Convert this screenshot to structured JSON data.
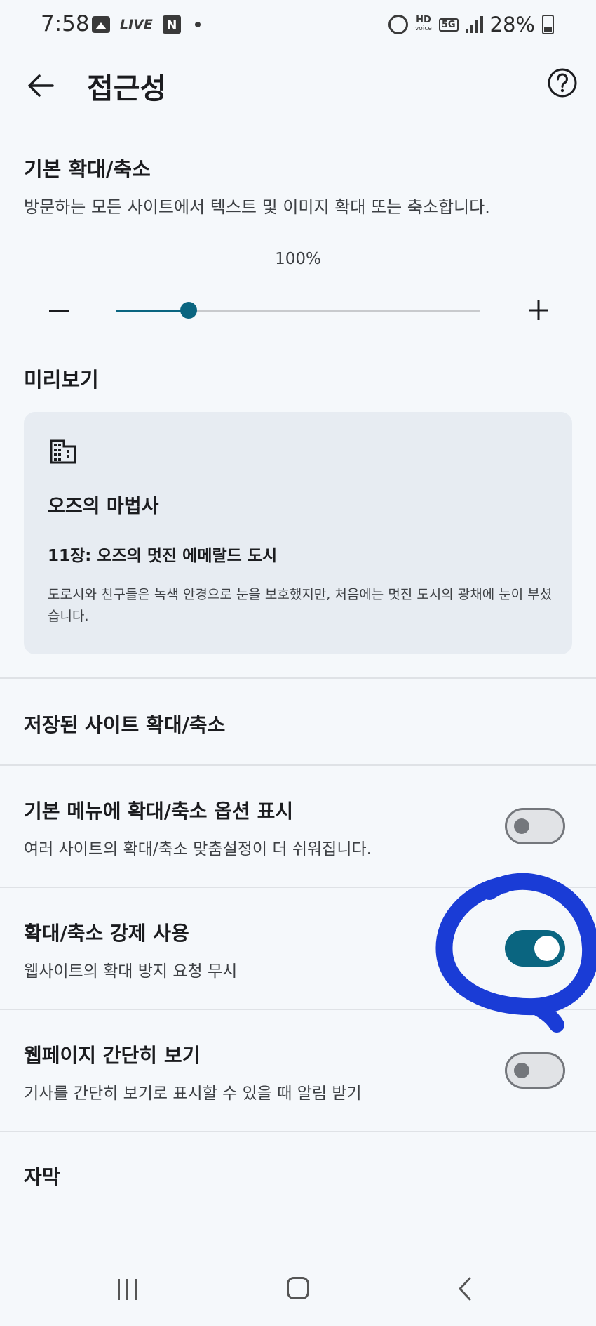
{
  "status_bar": {
    "time": "7:58",
    "live_label": "LIVE",
    "n_label": "N",
    "hd_label": "HD",
    "voice_label": "voice",
    "network_label": "5G",
    "battery": "28%",
    "icons": [
      "gallery-icon",
      "live-icon",
      "n-icon",
      "dot-icon",
      "alarm-icon",
      "hd-voice-icon",
      "5g-icon",
      "signal-icon",
      "battery-icon"
    ]
  },
  "app_bar": {
    "title": "접근성",
    "icons": [
      "back-arrow-icon",
      "help-icon"
    ]
  },
  "default_zoom": {
    "title": "기본 확대/축소",
    "subtitle": "방문하는 모든 사이트에서 텍스트 및 이미지 확대 또는 축소합니다.",
    "value_text": "100%",
    "slider_fraction": 0.2,
    "icons": [
      "minus-icon",
      "plus-icon"
    ]
  },
  "preview": {
    "heading": "미리보기",
    "book_title": "오즈의 마법사",
    "chapter": "11장: 오즈의 멋진 에메랄드 도시",
    "body": "도로시와 친구들은 녹색 안경으로 눈을 보호했지만, 처음에는 멋진 도시의 광채에 눈이 부셨습니다.",
    "icon": "building-icon"
  },
  "saved_zoom": {
    "title": "저장된 사이트 확대/축소"
  },
  "settings": [
    {
      "title": "기본 메뉴에 확대/축소 옵션 표시",
      "subtitle": "여러 사이트의 확대/축소 맞춤설정이 더 쉬워집니다.",
      "on": false
    },
    {
      "title": "확대/축소 강제 사용",
      "subtitle": "웹사이트의 확대 방지 요청 무시",
      "on": true
    },
    {
      "title": "웹페이지 간단히 보기",
      "subtitle": "기사를 간단히 보기로 표시할 수 있을 때 알림 받기",
      "on": false
    }
  ],
  "captions": {
    "title": "자막"
  },
  "colors": {
    "accent": "#0a6580",
    "background": "#f5f8fb",
    "card": "#e7ecf2",
    "annotation": "#1a3cd6"
  },
  "nav_bar": {
    "icons": [
      "recents-icon",
      "home-icon",
      "back-icon"
    ]
  }
}
